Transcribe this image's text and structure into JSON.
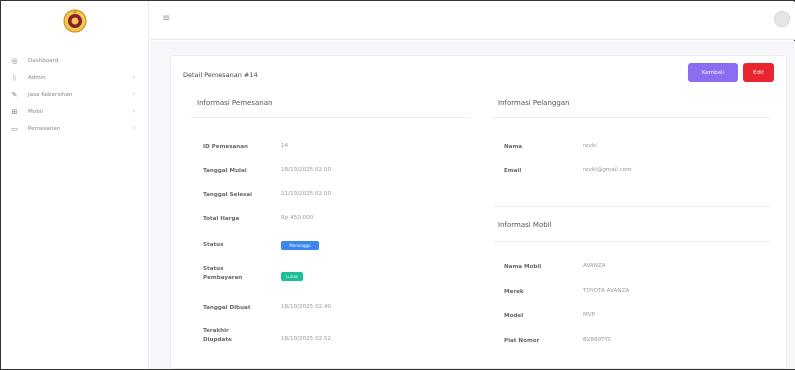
{
  "sidebar": {
    "items": [
      {
        "icon": "◎",
        "icon_name": "dashboard-icon",
        "label": "Dashboard",
        "has_chevron": false
      },
      {
        "icon": "ᚢ",
        "icon_name": "admin-icon",
        "label": "Admin",
        "has_chevron": true
      },
      {
        "icon": "✎",
        "icon_name": "tools-icon",
        "label": "Jasa Kebersihan",
        "has_chevron": true
      },
      {
        "icon": "⊞",
        "icon_name": "car-icon",
        "label": "Mobil",
        "has_chevron": true
      },
      {
        "icon": "▭",
        "icon_name": "order-icon",
        "label": "Pemesanan",
        "has_chevron": true
      }
    ],
    "chevron": "›"
  },
  "topbar": {
    "menu_icon": "≡"
  },
  "card": {
    "title": "Detail Pemesanan #14",
    "back_label": "Kembali",
    "edit_label": "Edit"
  },
  "pemesanan": {
    "title": "Informasi Pemesanan",
    "rows": [
      {
        "label": "ID Pemesanan",
        "value": "14"
      },
      {
        "label": "Tanggal Mulai",
        "value": "18/10/2025 02.00"
      },
      {
        "label": "Tanggal Selesai",
        "value": "21/10/2025 02.00"
      },
      {
        "label": "Total Harga",
        "value": "Rp 450.000"
      },
      {
        "label": "Status",
        "badge": "Menunggu"
      },
      {
        "label": "Status Pembayaran",
        "badge": "Lunas"
      },
      {
        "label": "Tanggal Dibuat",
        "value": "18/10/2025 02.40"
      },
      {
        "label": "Terakhir Diupdate",
        "value": "18/10/2025 02.52"
      }
    ]
  },
  "pelanggan": {
    "title": "Informasi Pelanggan",
    "rows": [
      {
        "label": "Nama",
        "value": "revki"
      },
      {
        "label": "Email",
        "value": "revki@gmail.com"
      }
    ]
  },
  "mobil": {
    "title": "Informasi Mobil",
    "rows": [
      {
        "label": "Nama Mobil",
        "value": "AVANZA"
      },
      {
        "label": "Merek",
        "value": "TOYOTA AVANZA"
      },
      {
        "label": "Model",
        "value": "MVP"
      },
      {
        "label": "Plat Nomor",
        "value": "B2880TYC"
      }
    ]
  },
  "colors": {
    "back_button": "#8c6cf0",
    "edit_button": "#ea2430",
    "badge_status": "#3d85ee",
    "badge_payment": "#1bbf9a"
  }
}
